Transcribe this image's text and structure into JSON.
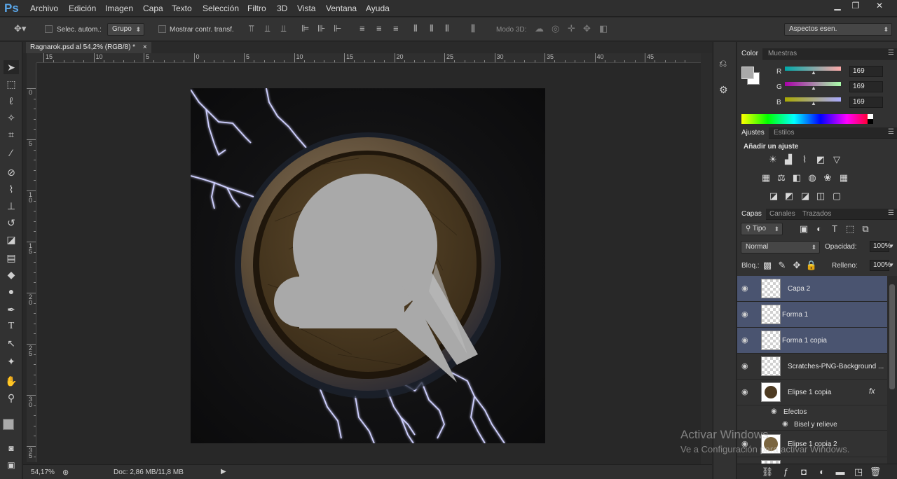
{
  "app": {
    "logo": "Ps"
  },
  "menu": [
    "Archivo",
    "Edición",
    "Imagen",
    "Capa",
    "Texto",
    "Selección",
    "Filtro",
    "3D",
    "Vista",
    "Ventana",
    "Ayuda"
  ],
  "window_controls": {
    "minimize": "▁",
    "restore": "❐",
    "close": "✕"
  },
  "options": {
    "auto_select_label": "Selec. autom.:",
    "auto_select_value": "Grupo",
    "transform_label": "Mostrar contr. transf.",
    "mode3d_label": "Modo 3D:",
    "workspace": "Aspectos esen."
  },
  "document": {
    "tab_title": "Ragnarok.psd al 54,2% (RGB/8) *",
    "close": "×",
    "ruler_h": [
      "15",
      "10",
      "5",
      "0",
      "5",
      "10",
      "15",
      "20",
      "25",
      "30",
      "35",
      "40",
      "45"
    ],
    "ruler_v": [
      "0",
      "5",
      "1 0",
      "1 5",
      "2 0",
      "2 5",
      "3 0",
      "3 5"
    ]
  },
  "status": {
    "zoom": "54,17%",
    "doc": "Doc: 2,86 MB/11,8 MB"
  },
  "color_panel": {
    "tabs": [
      "Color",
      "Muestras"
    ],
    "channels": [
      {
        "label": "R",
        "value": "169"
      },
      {
        "label": "G",
        "value": "169"
      },
      {
        "label": "B",
        "value": "169"
      }
    ],
    "foreground": "#a9a9a9",
    "background": "#ffffff"
  },
  "adjust_panel": {
    "tabs": [
      "Ajustes",
      "Estilos"
    ],
    "title": "Añadir un ajuste"
  },
  "layers_panel": {
    "tabs": [
      "Capas",
      "Canales",
      "Trazados"
    ],
    "filter": "Tipo",
    "blend_mode": "Normal",
    "opacity_label": "Opacidad:",
    "opacity": "100%",
    "lock_label": "Bloq.:",
    "fill_label": "Relleno:",
    "fill": "100%",
    "layers": [
      {
        "name": "Capa 2",
        "selected": true
      },
      {
        "name": "Forma 1",
        "selected": true
      },
      {
        "name": "Forma 1 copia",
        "selected": true
      },
      {
        "name": "Scratches-PNG-Background ...",
        "selected": false
      },
      {
        "name": "Elipse 1 copia",
        "selected": false,
        "fx": "fx"
      },
      {
        "name": "Elipse 1 copia 2",
        "selected": false
      }
    ],
    "effects_label": "Efectos",
    "effect_item": "Bisel y relieve"
  },
  "watermark": {
    "line1": "Activar Windows",
    "line2": "Ve a Configuración para activar Windows."
  },
  "colors": {
    "accent": "#4a5470",
    "canvas": "#141414",
    "bubble": "#a9a9a9",
    "wood": "#4e3b22"
  }
}
